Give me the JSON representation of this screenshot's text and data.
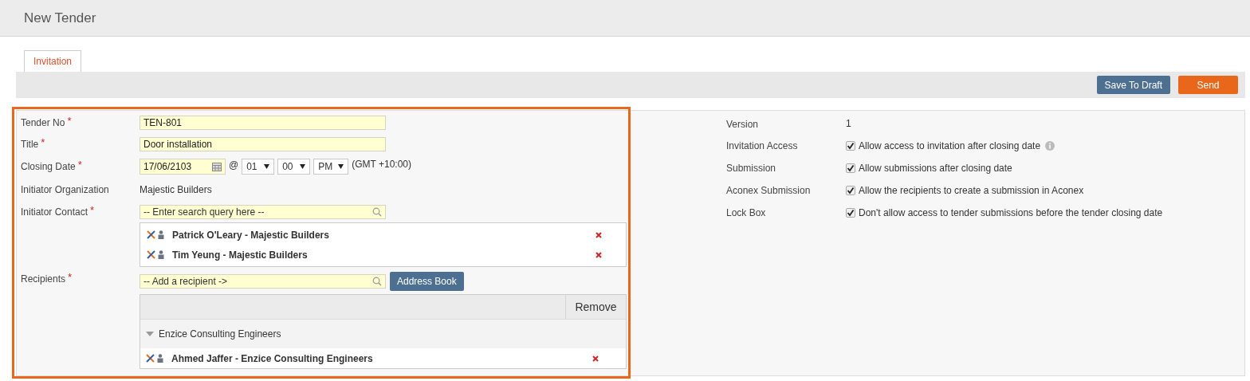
{
  "page_title": "New Tender",
  "tabs": [
    {
      "label": "Invitation",
      "selected": true
    }
  ],
  "toolbar": [
    {
      "label": "Save To Draft",
      "kind": "secondary"
    },
    {
      "label": "Send",
      "kind": "primary"
    }
  ],
  "left_section": {
    "highlighted": true,
    "fields": [
      {
        "kind": "text",
        "label": "Tender No",
        "required_mark": "*",
        "value": "TEN-801"
      },
      {
        "kind": "text",
        "label": "Title",
        "required_mark": "*",
        "value": "Door installation"
      },
      {
        "kind": "datetime",
        "label": "Closing Date",
        "required_mark": "*",
        "date": "17/06/2103",
        "at": "@",
        "hour": "01",
        "minute": "00",
        "ampm": "PM",
        "timezone": "(GMT +10:00)"
      },
      {
        "kind": "static",
        "label": "Initiator Organization",
        "value": "Majestic Builders"
      },
      {
        "kind": "contacts",
        "label": "Initiator Contact",
        "required_mark": "*",
        "placeholder": "-- Enter search query here --",
        "contacts": [
          {
            "name": "Patrick O'Leary - Majestic Builders"
          },
          {
            "name": "Tim Yeung - Majestic Builders"
          }
        ]
      },
      {
        "kind": "recipients",
        "label": "Recipients",
        "required_mark": "*",
        "placeholder": "-- Add a recipient ->",
        "button": "Address Book",
        "remove_header": "Remove",
        "groups": [
          {
            "name": "Enzice Consulting Engineers",
            "expanded": true,
            "members": [
              {
                "name": "Ahmed Jaffer - Enzice Consulting Engineers"
              }
            ]
          }
        ]
      }
    ]
  },
  "right_section": {
    "fields": [
      {
        "kind": "static",
        "label": "Version",
        "value": "1"
      },
      {
        "kind": "checkbox",
        "label": "Invitation Access",
        "checked": true,
        "text": "Allow access to invitation after closing date",
        "info": true
      },
      {
        "kind": "checkbox",
        "label": "Submission",
        "checked": true,
        "text": "Allow submissions after closing date",
        "info": false
      },
      {
        "kind": "checkbox",
        "label": "Aconex Submission",
        "checked": true,
        "text": "Allow the recipients to create a submission in Aconex",
        "info": false
      },
      {
        "kind": "checkbox",
        "label": "Lock Box",
        "checked": true,
        "text": "Don't allow access to tender submissions before the tender closing date",
        "info": false
      }
    ]
  }
}
